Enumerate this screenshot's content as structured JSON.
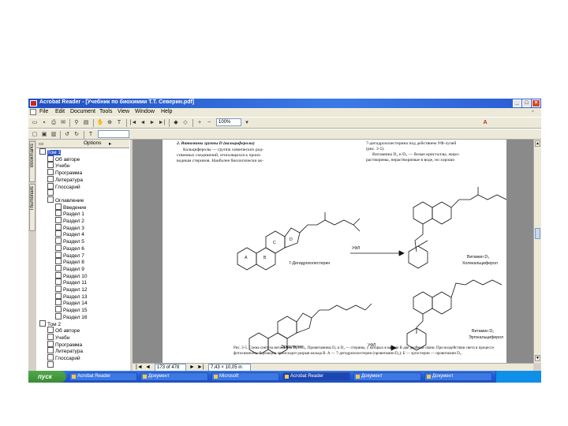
{
  "window": {
    "title": "Acrobat Reader - [Учебник по биохимии Т.Т. Северин.pdf]",
    "controls": [
      "_",
      "□",
      "×"
    ],
    "colors": {
      "titlebar": "#2a5bd4",
      "desktop": "#ffffff",
      "chrome": "#d4d0c8",
      "taskbar": "#245edb",
      "start": "#3a8c35"
    }
  },
  "menu": {
    "items": [
      "File",
      "Edit",
      "Document",
      "Tools",
      "View",
      "Window",
      "Help"
    ],
    "doc_menu_icon": "document-icon"
  },
  "toolbar": {
    "zoom_value": "100%",
    "find_label": "T",
    "search_placeholder": ""
  },
  "sidebar": {
    "tabs": [
      "Bookmarks",
      "Thumbnails"
    ],
    "header_label": "Options",
    "tree": [
      {
        "label": "Том 1",
        "level": 0,
        "selected": true
      },
      {
        "label": "Об авторе",
        "level": 1
      },
      {
        "label": "Учебн",
        "level": 1
      },
      {
        "label": "Программа",
        "level": 1
      },
      {
        "label": "Литература",
        "level": 1
      },
      {
        "label": "Глоссарий",
        "level": 1
      },
      {
        "label": "",
        "level": 1
      },
      {
        "label": "Оглавление",
        "level": 1
      },
      {
        "label": "Введение",
        "level": 2
      },
      {
        "label": "Раздел 1",
        "level": 2
      },
      {
        "label": "Раздел 2",
        "level": 2
      },
      {
        "label": "Раздел 3",
        "level": 2
      },
      {
        "label": "Раздел 4",
        "level": 2
      },
      {
        "label": "Раздел 5",
        "level": 2
      },
      {
        "label": "Раздел 6",
        "level": 2
      },
      {
        "label": "Раздел 7",
        "level": 2
      },
      {
        "label": "Раздел 8",
        "level": 2
      },
      {
        "label": "Раздел 9",
        "level": 2
      },
      {
        "label": "Раздел 10",
        "level": 2
      },
      {
        "label": "Раздел 11",
        "level": 2
      },
      {
        "label": "Раздел 12",
        "level": 2
      },
      {
        "label": "Раздел 13",
        "level": 2
      },
      {
        "label": "Раздел 14",
        "level": 2
      },
      {
        "label": "Раздел 15",
        "level": 2
      },
      {
        "label": "Раздел 16",
        "level": 2
      },
      {
        "label": "Том 2",
        "level": 0
      },
      {
        "label": "Об авторе",
        "level": 1
      },
      {
        "label": "Учебн",
        "level": 1
      },
      {
        "label": "Программа",
        "level": 1
      },
      {
        "label": "Литература",
        "level": 1
      },
      {
        "label": "Глоссарий",
        "level": 1
      },
      {
        "label": "",
        "level": 1
      }
    ]
  },
  "document": {
    "left_col": [
      "2. Витамины группы D (кальциферолы)",
      "Кальциферолы — группа химических род-",
      "ственных соединений, относящихся к произ-",
      "водным стеринов. Наиболее биологически ак-"
    ],
    "right_col": [
      "7-дегидрохолестерина под действием УФ-лучей",
      "(рис. 3-5).",
      "Витамины D₂ и D₃ — белые кристаллы, жирo-",
      "растворимы, нерастворимые в воде, но хорошо"
    ],
    "labels": {
      "dehydro": "7-Дегидрохолестерин",
      "ergo": "Эргостерин",
      "uv_top": "УФЛ",
      "uv_bottom": "УФЛ",
      "vit_d3": "Витамин D₃",
      "vit_d3_name": "Холекальциферол",
      "vit_d2": "Витамин D₂",
      "vit_d2_name": "Эргокальциферол",
      "ring_letters": [
        "A",
        "B",
        "C",
        "D"
      ]
    },
    "caption": "Рис. 3-5. Схема синтеза витаминов D₂ и D₃. Провитамины D₂ и D₃ — стерины, у которых в кольце В две двойные связи. При воздействии света в процессе фотохимической реакции происходит разрыв кольца В. А — 7-дегидрохолестерин (провитамин D₃); Б — эргостерин — провитамин D₂."
  },
  "statusbar": {
    "page_display": "173 of 478",
    "page_size": "7,43 × 10,05 in",
    "nav": [
      "|◄",
      "◄",
      "►",
      "►|"
    ]
  },
  "taskbar": {
    "start_label": "пуск",
    "tasks": [
      {
        "label": "Acrobat Reader"
      },
      {
        "label": "Документ"
      },
      {
        "label": "Microsoft"
      },
      {
        "label": "Acrobat Reader",
        "active": true
      },
      {
        "label": "Документ"
      },
      {
        "label": "Документ"
      }
    ],
    "clock": ""
  }
}
